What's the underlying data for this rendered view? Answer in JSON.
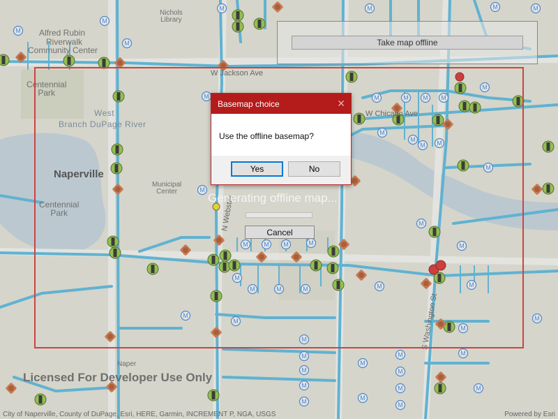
{
  "map": {
    "labels": {
      "nichols_library": "Nichols\nLibrary",
      "alfred_rubin": "Alfred Rubin",
      "riverwalk": "Riverwalk",
      "community_center": "Community Center",
      "centennial_park_top": "Centennial\nPark",
      "west": "West",
      "branch_dupage_river": "Branch DuPage River",
      "naperville": "Naperville",
      "municipal_center": "Municipal\nCenter",
      "centennial_park_left": "Centennial\nPark",
      "webster": "N Webster",
      "washington": "S Washington St",
      "jackson_ave": "W Jackson Ave",
      "chicago_ave": "W Chicago Ave",
      "naper": "Naper"
    },
    "watermark": "Licensed For Developer Use Only",
    "attribution_left": "City of Naperville, County of DuPage, Esri, HERE, Garmin, INCREMENT P, NGA, USGS",
    "attribution_right": "Powered by Esri",
    "colors": {
      "background": "#d8d8cf",
      "lines": "#4aaed6",
      "green_node": "#88bd3a",
      "orange_node": "#c8683a",
      "meter_ring": "#3a78c8",
      "area_border": "#cc4444",
      "dialog_title_bg": "#b41b1b"
    }
  },
  "panel": {
    "take_offline_label": "Take map offline"
  },
  "progress": {
    "text": "Generating offline map...",
    "percent": 0,
    "cancel_label": "Cancel"
  },
  "dialog": {
    "title": "Basemap choice",
    "close_icon": "close-icon",
    "message": "Use the offline basemap?",
    "yes_label": "Yes",
    "no_label": "No"
  }
}
